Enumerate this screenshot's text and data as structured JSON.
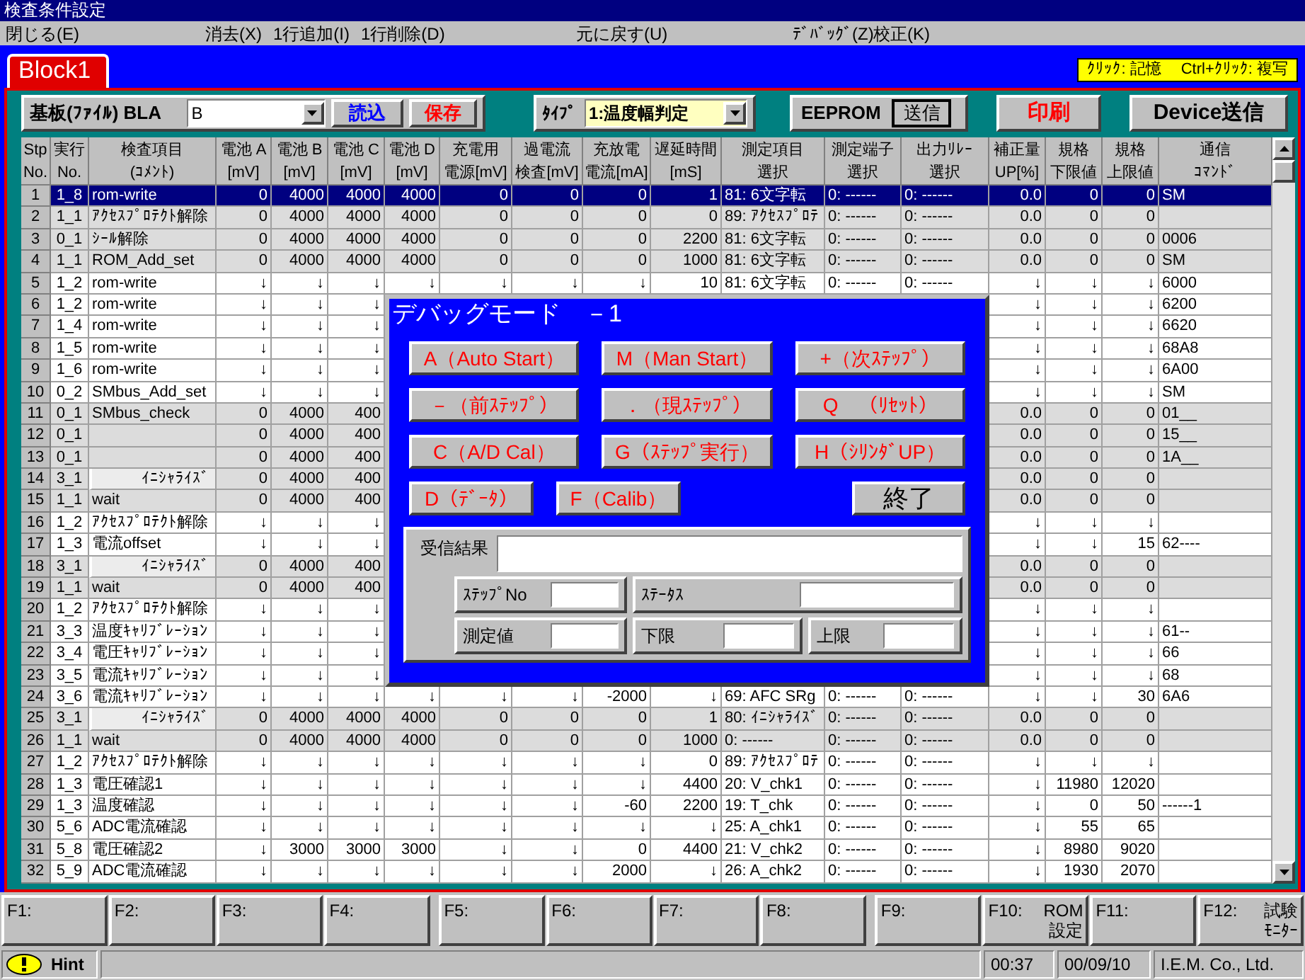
{
  "window": {
    "title": "検査条件設定"
  },
  "menu": [
    "閉じる(E)",
    "消去(X)",
    "1行追加(I)",
    "1行削除(D)",
    "元に戻す(U)",
    "ﾃﾞﾊﾞｯｸﾞ(Z)",
    "校正(K)"
  ],
  "tab": "Block1",
  "hint_box": [
    "ｸﾘｯｸ: 記憶",
    "Ctrl+ｸﾘｯｸ: 複写"
  ],
  "toolbar": {
    "board_label": "基板(ﾌｧｲﾙ) BLA",
    "board_value": "B",
    "load_button": "読込",
    "save_button": "保存",
    "type_label": "ﾀｲﾌﾟ",
    "type_value": "1:温度幅判定",
    "eeprom_label": "EEPROM",
    "send_button": "送信",
    "print_button": "印刷",
    "device_button": "Device送信"
  },
  "table": {
    "columns": [
      {
        "line1": "Stp",
        "line2": "No."
      },
      {
        "line1": "実行",
        "line2": "No."
      },
      {
        "line1": "検査項目",
        "line2": "(ｺﾒﾝﾄ)"
      },
      {
        "line1": "電池 A",
        "line2": "[mV]"
      },
      {
        "line1": "電池 B",
        "line2": "[mV]"
      },
      {
        "line1": "電池 C",
        "line2": "[mV]"
      },
      {
        "line1": "電池 D",
        "line2": "[mV]"
      },
      {
        "line1": "充電用",
        "line2": "電源[mV]"
      },
      {
        "line1": "過電流",
        "line2": "検査[mV]"
      },
      {
        "line1": "充放電",
        "line2": "電流[mA]"
      },
      {
        "line1": "遅延時間",
        "line2": "[mS]"
      },
      {
        "line1": "測定項目",
        "line2": "選択"
      },
      {
        "line1": "測定端子",
        "line2": "選択"
      },
      {
        "line1": "出力ﾘﾚｰ",
        "line2": "選択"
      },
      {
        "line1": "補正量",
        "line2": "UP[%]"
      },
      {
        "line1": "規格",
        "line2": "下限値"
      },
      {
        "line1": "規格",
        "line2": "上限値"
      },
      {
        "line1": "通信",
        "line2": "ｺﾏﾝﾄﾞ"
      }
    ],
    "rows": [
      {
        "selected": true,
        "kind": "step",
        "cells": [
          "1",
          "1_8",
          "rom-write",
          "0",
          "4000",
          "4000",
          "4000",
          "0",
          "0",
          "0",
          "1",
          "81: 6文字転",
          "0: ------",
          "0: ------",
          "0.0",
          "0",
          "0",
          "SM"
        ]
      },
      {
        "selected": false,
        "shaded": true,
        "kind": "step",
        "cells": [
          "2",
          "1_1",
          "ｱｸｾｽﾌﾟﾛﾃｸﾄ解除",
          "0",
          "4000",
          "4000",
          "4000",
          "0",
          "0",
          "0",
          "0",
          "89: ｱｸｾｽﾌﾟﾛﾃ",
          "0: ------",
          "0: ------",
          "0.0",
          "0",
          "0",
          null
        ]
      },
      {
        "selected": false,
        "shaded": true,
        "kind": "step",
        "cells": [
          "3",
          "0_1",
          "ｼｰﾙ解除",
          "0",
          "4000",
          "4000",
          "4000",
          "0",
          "0",
          "0",
          "2200",
          "81: 6文字転",
          "0: ------",
          "0: ------",
          "0.0",
          "0",
          "0",
          "0006"
        ]
      },
      {
        "selected": false,
        "shaded": true,
        "kind": "step",
        "cells": [
          "4",
          "1_1",
          "ROM_Add_set",
          "0",
          "4000",
          "4000",
          "4000",
          "0",
          "0",
          "0",
          "1000",
          "81: 6文字転",
          "0: ------",
          "0: ------",
          "0.0",
          "0",
          "0",
          "SM"
        ]
      },
      {
        "selected": false,
        "shaded": false,
        "kind": "step",
        "cells": [
          "5",
          "1_2",
          "rom-write",
          "↓",
          "↓",
          "↓",
          "↓",
          "↓",
          "↓",
          "↓",
          "10",
          "81: 6文字転",
          "0: ------",
          "0: ------",
          "↓",
          "↓",
          "↓",
          "6000"
        ]
      },
      {
        "selected": false,
        "shaded": false,
        "kind": "step",
        "cells": [
          "6",
          "1_2",
          "rom-write",
          "↓",
          "↓",
          "↓",
          null,
          null,
          null,
          null,
          null,
          null,
          null,
          null,
          "↓",
          "↓",
          "↓",
          "6200"
        ]
      },
      {
        "selected": false,
        "shaded": false,
        "kind": "step",
        "cells": [
          "7",
          "1_4",
          "rom-write",
          "↓",
          "↓",
          "↓",
          null,
          null,
          null,
          null,
          null,
          null,
          null,
          null,
          "↓",
          "↓",
          "↓",
          "6620"
        ]
      },
      {
        "selected": false,
        "shaded": false,
        "kind": "step",
        "cells": [
          "8",
          "1_5",
          "rom-write",
          "↓",
          "↓",
          "↓",
          null,
          null,
          null,
          null,
          null,
          null,
          null,
          null,
          "↓",
          "↓",
          "↓",
          "68A8"
        ]
      },
      {
        "selected": false,
        "shaded": false,
        "kind": "step",
        "cells": [
          "9",
          "1_6",
          "rom-write",
          "↓",
          "↓",
          "↓",
          null,
          null,
          null,
          null,
          null,
          null,
          null,
          null,
          "↓",
          "↓",
          "↓",
          "6A00"
        ]
      },
      {
        "selected": false,
        "shaded": false,
        "kind": "step",
        "cells": [
          "10",
          "0_2",
          "SMbus_Add_set",
          "↓",
          "↓",
          "↓",
          null,
          null,
          null,
          null,
          null,
          null,
          null,
          null,
          "↓",
          "↓",
          "↓",
          "SM"
        ]
      },
      {
        "selected": false,
        "shaded": true,
        "kind": "step",
        "cells": [
          "11",
          "0_1",
          "SMbus_check",
          "0",
          "4000",
          "400",
          null,
          null,
          null,
          null,
          null,
          null,
          null,
          null,
          "0.0",
          "0",
          "0",
          "01__"
        ]
      },
      {
        "selected": false,
        "shaded": true,
        "kind": "step",
        "cells": [
          "12",
          "0_1",
          null,
          "0",
          "4000",
          "400",
          null,
          null,
          null,
          null,
          null,
          null,
          null,
          null,
          "0.0",
          "0",
          "0",
          "15__"
        ]
      },
      {
        "selected": false,
        "shaded": true,
        "kind": "step",
        "cells": [
          "13",
          "0_1",
          null,
          "0",
          "4000",
          "400",
          null,
          null,
          null,
          null,
          null,
          null,
          null,
          null,
          "0.0",
          "0",
          "0",
          "1A__"
        ]
      },
      {
        "selected": false,
        "shaded": true,
        "kind": "init",
        "cells": [
          "14",
          "3_1",
          "ｲﾆｼｬﾗｲｽﾞ",
          "0",
          "4000",
          "400",
          null,
          null,
          null,
          null,
          null,
          null,
          null,
          null,
          "0.0",
          "0",
          "0",
          null
        ]
      },
      {
        "selected": false,
        "shaded": true,
        "kind": "step",
        "cells": [
          "15",
          "1_1",
          "wait",
          "0",
          "4000",
          "400",
          null,
          null,
          null,
          null,
          null,
          null,
          null,
          null,
          "0.0",
          "0",
          "0",
          null
        ]
      },
      {
        "selected": false,
        "shaded": false,
        "kind": "step",
        "cells": [
          "16",
          "1_2",
          "ｱｸｾｽﾌﾟﾛﾃｸﾄ解除",
          "↓",
          "↓",
          "↓",
          null,
          null,
          null,
          null,
          null,
          null,
          null,
          null,
          "↓",
          "↓",
          "↓",
          null
        ]
      },
      {
        "selected": false,
        "shaded": false,
        "kind": "step",
        "cells": [
          "17",
          "1_3",
          "電流offset",
          "↓",
          "↓",
          "↓",
          null,
          null,
          null,
          null,
          null,
          null,
          null,
          null,
          "↓",
          "↓",
          "15",
          "62----"
        ]
      },
      {
        "selected": false,
        "shaded": true,
        "kind": "init",
        "cells": [
          "18",
          "3_1",
          "ｲﾆｼｬﾗｲｽﾞ",
          "0",
          "4000",
          "400",
          null,
          null,
          null,
          null,
          null,
          null,
          null,
          null,
          "0.0",
          "0",
          "0",
          null
        ]
      },
      {
        "selected": false,
        "shaded": true,
        "kind": "step",
        "cells": [
          "19",
          "1_1",
          "wait",
          "0",
          "4000",
          "400",
          null,
          null,
          null,
          null,
          null,
          null,
          null,
          null,
          "0.0",
          "0",
          "0",
          null
        ]
      },
      {
        "selected": false,
        "shaded": false,
        "kind": "step",
        "cells": [
          "20",
          "1_2",
          "ｱｸｾｽﾌﾟﾛﾃｸﾄ解除",
          "↓",
          "↓",
          "↓",
          null,
          null,
          null,
          null,
          null,
          null,
          null,
          null,
          "↓",
          "↓",
          "↓",
          null
        ]
      },
      {
        "selected": false,
        "shaded": false,
        "kind": "step",
        "cells": [
          "21",
          "3_3",
          "温度ｷｬﾘﾌﾞﾚｰｼｮﾝ",
          "↓",
          "↓",
          "↓",
          null,
          null,
          null,
          null,
          null,
          null,
          null,
          null,
          "↓",
          "↓",
          "↓",
          "61--"
        ]
      },
      {
        "selected": false,
        "shaded": false,
        "kind": "step",
        "cells": [
          "22",
          "3_4",
          "電圧ｷｬﾘﾌﾞﾚｰｼｮﾝ",
          "↓",
          "↓",
          "↓",
          null,
          null,
          null,
          null,
          null,
          null,
          null,
          null,
          "↓",
          "↓",
          "↓",
          "66"
        ]
      },
      {
        "selected": false,
        "shaded": false,
        "kind": "step",
        "cells": [
          "23",
          "3_5",
          "電流ｷｬﾘﾌﾞﾚｰｼｮﾝ",
          "↓",
          "↓",
          "↓",
          null,
          null,
          null,
          null,
          null,
          null,
          null,
          null,
          "↓",
          "↓",
          "↓",
          "68"
        ]
      },
      {
        "selected": false,
        "shaded": false,
        "kind": "step",
        "cells": [
          "24",
          "3_6",
          "電流ｷｬﾘﾌﾞﾚｰｼｮﾝ",
          "↓",
          "↓",
          "↓",
          "↓",
          "↓",
          "↓",
          "-2000",
          "↓",
          "69: AFC SRg",
          "0: ------",
          "0: ------",
          "↓",
          "↓",
          "30",
          "6A6"
        ]
      },
      {
        "selected": false,
        "shaded": true,
        "kind": "init",
        "cells": [
          "25",
          "3_1",
          "ｲﾆｼｬﾗｲｽﾞ",
          "0",
          "4000",
          "4000",
          "4000",
          "0",
          "0",
          "0",
          "1",
          "80: ｲﾆｼｬﾗｲｽﾞ",
          "0: ------",
          "0: ------",
          "0.0",
          "0",
          "0",
          null
        ]
      },
      {
        "selected": false,
        "shaded": true,
        "kind": "step",
        "cells": [
          "26",
          "1_1",
          "wait",
          "0",
          "4000",
          "4000",
          "4000",
          "0",
          "0",
          "0",
          "1000",
          "0: ------",
          "0: ------",
          "0: ------",
          "0.0",
          "0",
          "0",
          null
        ]
      },
      {
        "selected": false,
        "shaded": false,
        "kind": "step",
        "cells": [
          "27",
          "1_2",
          "ｱｸｾｽﾌﾟﾛﾃｸﾄ解除",
          "↓",
          "↓",
          "↓",
          "↓",
          "↓",
          "↓",
          "↓",
          "0",
          "89: ｱｸｾｽﾌﾟﾛﾃ",
          "0: ------",
          "0: ------",
          "↓",
          "↓",
          "↓",
          null
        ]
      },
      {
        "selected": false,
        "shaded": false,
        "kind": "step",
        "cells": [
          "28",
          "1_3",
          "電圧確認1",
          "↓",
          "↓",
          "↓",
          "↓",
          "↓",
          "↓",
          "↓",
          "4400",
          "20: V_chk1",
          "0: ------",
          "0: ------",
          "↓",
          "11980",
          "12020",
          null
        ]
      },
      {
        "selected": false,
        "shaded": false,
        "kind": "step",
        "cells": [
          "29",
          "1_3",
          "温度確認",
          "↓",
          "↓",
          "↓",
          "↓",
          "↓",
          "↓",
          "-60",
          "2200",
          "19: T_chk",
          "0: ------",
          "0: ------",
          "↓",
          "0",
          "50",
          "------1"
        ]
      },
      {
        "selected": false,
        "shaded": false,
        "kind": "step",
        "cells": [
          "30",
          "5_6",
          "ADC電流確認",
          "↓",
          "↓",
          "↓",
          "↓",
          "↓",
          "↓",
          "↓",
          "↓",
          "25: A_chk1",
          "0: ------",
          "0: ------",
          "↓",
          "55",
          "65",
          null
        ]
      },
      {
        "selected": false,
        "shaded": false,
        "kind": "step",
        "cells": [
          "31",
          "5_8",
          "電圧確認2",
          "↓",
          "3000",
          "3000",
          "3000",
          "↓",
          "↓",
          "0",
          "4400",
          "21: V_chk2",
          "0: ------",
          "0: ------",
          "↓",
          "8980",
          "9020",
          null
        ]
      },
      {
        "selected": false,
        "shaded": false,
        "kind": "step",
        "cells": [
          "32",
          "5_9",
          "ADC電流確認",
          "↓",
          "↓",
          "↓",
          "↓",
          "↓",
          "↓",
          "2000",
          "↓",
          "26: A_chk2",
          "0: ------",
          "0: ------",
          "↓",
          "1930",
          "2070",
          null
        ]
      }
    ]
  },
  "dialog": {
    "title": "デバッグモード　－1",
    "buttons": [
      {
        "label": "A（Auto Start）",
        "kind": "command"
      },
      {
        "label": "M（Man Start）",
        "kind": "command"
      },
      {
        "label": "+（次ｽﾃｯﾌﾟ）",
        "kind": "command"
      },
      {
        "label": "－（前ｽﾃｯﾌﾟ）",
        "kind": "command"
      },
      {
        "label": "．（現ｽﾃｯﾌﾟ）",
        "kind": "command"
      },
      {
        "label": "Q　（ﾘｾｯﾄ）",
        "kind": "command"
      },
      {
        "label": "C（A/D Cal）",
        "kind": "command"
      },
      {
        "label": "G（ｽﾃｯﾌﾟ実行）",
        "kind": "command"
      },
      {
        "label": "H（ｼﾘﾝﾀﾞUP）",
        "kind": "command"
      },
      {
        "label": "D（ﾃﾞｰﾀ）",
        "kind": "command"
      },
      {
        "label": "F（Calib）",
        "kind": "command"
      },
      {
        "label": "終了",
        "kind": "close"
      }
    ],
    "result_label": "受信結果",
    "fields": [
      {
        "label": "ｽﾃｯﾌﾟNo"
      },
      {
        "label": "ｽﾃｰﾀｽ"
      },
      {
        "label": "測定値"
      },
      {
        "label": "下限"
      },
      {
        "label": "上限"
      }
    ]
  },
  "function_keys": [
    {
      "key": "F1:"
    },
    {
      "key": "F2:"
    },
    {
      "key": "F3:"
    },
    {
      "key": "F4:"
    },
    {
      "key": "F5:"
    },
    {
      "key": "F6:"
    },
    {
      "key": "F7:"
    },
    {
      "key": "F8:"
    },
    {
      "key": "F9:"
    },
    {
      "key": "F10:",
      "lines": [
        "ROM",
        "設定"
      ]
    },
    {
      "key": "F11:"
    },
    {
      "key": "F12:",
      "lines": [
        "試験",
        "ﾓﾆﾀｰ"
      ]
    }
  ],
  "status_bar": {
    "hint": "Hint",
    "time": "00:37",
    "date": "00/09/10",
    "company": "I.E.M. Co., Ltd."
  }
}
